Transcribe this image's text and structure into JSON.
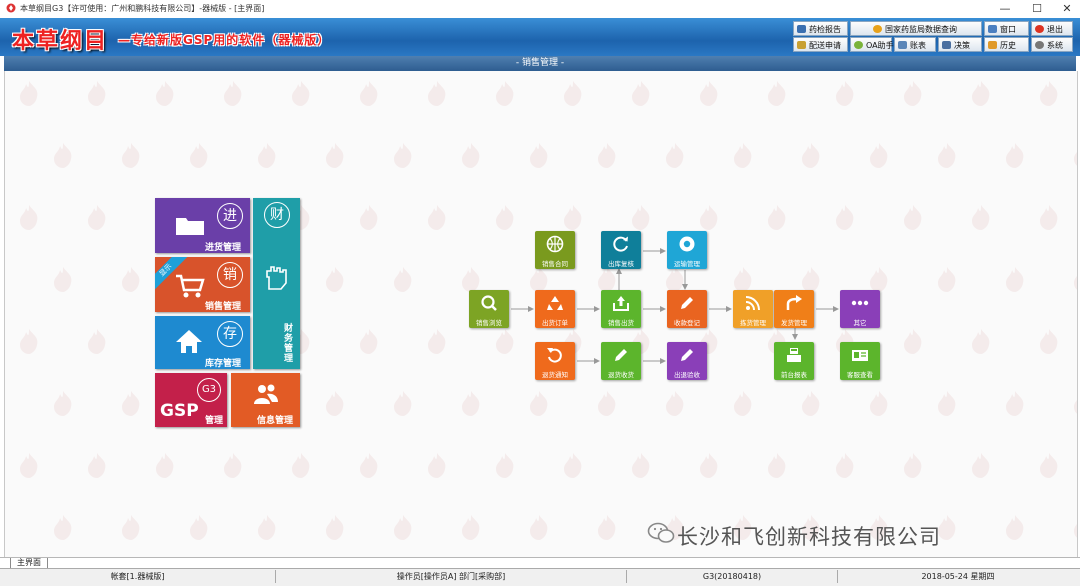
{
  "window": {
    "title": "本草纲目G3【许可使用：广州和鹏科技有限公司】-器械版 - [主界面]",
    "minimize": "—",
    "maximize": "☐",
    "close": "✕"
  },
  "header": {
    "logo": "本草纲目",
    "subtitle": "—专给新版GSP用的软件（器械版）",
    "buttons": {
      "report": "药检报告",
      "bureau": "国家药监局数据查询",
      "window": "窗口",
      "exit": "退出",
      "delivery": "配送申请",
      "oa": "OA助手",
      "ledger": "账表",
      "decision": "决策",
      "history": "历史",
      "system": "系统"
    }
  },
  "band": {
    "title": "- 销售管理 -"
  },
  "tiles": {
    "purchase": {
      "label": "进货管理",
      "char": "进"
    },
    "sales": {
      "label": "销售管理",
      "char": "销",
      "ribbon": "显示"
    },
    "stock": {
      "label": "库存管理",
      "char": "存"
    },
    "finance": {
      "label": "财务管理",
      "char": "财"
    },
    "gsp": {
      "label": "GSP",
      "sub": "管理",
      "badge": "G3"
    },
    "info": {
      "label": "信息管理"
    }
  },
  "flow": {
    "contract": "销售合同",
    "reship": "出库复核",
    "transport": "运输管理",
    "browse": "销售浏览",
    "order": "出货订单",
    "salesout": "销售出货",
    "receipt": "收款登记",
    "pack": "拣货管理",
    "ship": "发货管理",
    "other": "其它",
    "returnnotice": "退货通知",
    "returnreceive": "退货收货",
    "returncheck": "出退验收",
    "front": "前台报表",
    "customer": "客服查看"
  },
  "brand": "长沙和飞创新科技有限公司",
  "tab": {
    "main": "主界面"
  },
  "status": {
    "account": "帐套[1.器械版]",
    "operator": "操作员[操作员A]  部门[采购部]",
    "version": "G3(20180418)",
    "date": "2018-05-24 星期四"
  }
}
